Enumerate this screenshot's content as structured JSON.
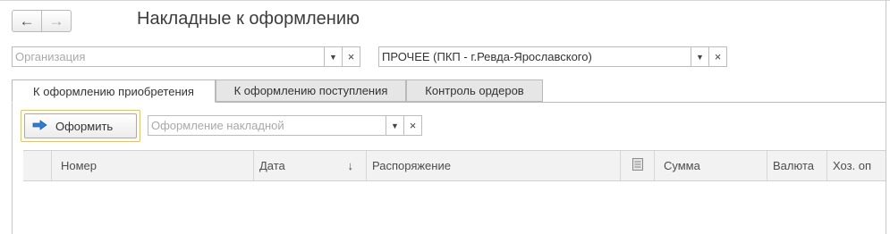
{
  "window": {
    "title": "Накладные к оформлению"
  },
  "nav": {
    "back_icon": "←",
    "forward_icon": "→"
  },
  "filters": {
    "organization": {
      "value": "",
      "placeholder": "Организация"
    },
    "warehouse": {
      "value": "ПРОЧЕЕ (ПКП - г.Ревда-Ярославского)",
      "placeholder": ""
    },
    "dropdown_icon": "▼",
    "clear_icon": "×"
  },
  "tabs": [
    {
      "label": "К оформлению приобретения",
      "active": true
    },
    {
      "label": "К оформлению поступления",
      "active": false
    },
    {
      "label": "Контроль ордеров",
      "active": false
    }
  ],
  "toolbar": {
    "action_label": "Оформить",
    "action_icon": "right-arrow-icon",
    "operation": {
      "value": "",
      "placeholder": "Оформление накладной"
    }
  },
  "table": {
    "columns": [
      {
        "label": ""
      },
      {
        "label": "Номер"
      },
      {
        "label": "Дата",
        "sort": "↓"
      },
      {
        "label": "Распоряжение"
      },
      {
        "label": "",
        "icon": "document-icon"
      },
      {
        "label": "Сумма"
      },
      {
        "label": "Валюта"
      },
      {
        "label": "Хоз. оп"
      }
    ],
    "rows": []
  },
  "colors": {
    "accent_border": "#e9c64a",
    "arrow_icon": "#2f7fd0"
  }
}
